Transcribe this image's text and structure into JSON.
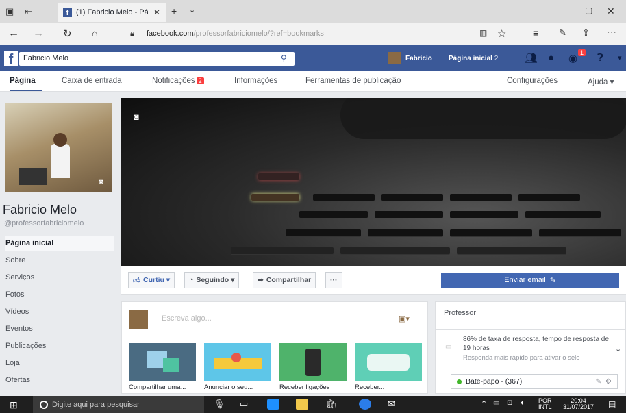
{
  "browser": {
    "tab_title": "(1) Fabricio Melo - Pági",
    "url_host": "facebook.com",
    "url_path": "/professorfabriciomelo/?ref=bookmarks",
    "fb_square": "f"
  },
  "fbbar": {
    "logo": "f",
    "search_value": "Fabricio Melo",
    "user_name": "Fabricio",
    "home_label": "Página inicial",
    "home_count": "2",
    "notif_count": "1"
  },
  "pagenav": {
    "tabs": [
      "Página",
      "Caixa de entrada",
      "Notificações",
      "Informações",
      "Ferramentas de publicação"
    ],
    "notif_badge": "2",
    "settings": "Configurações",
    "help": "Ajuda ▾"
  },
  "profile": {
    "name": "Fabricio Melo",
    "handle": "@professorfabriciomelo"
  },
  "sidebar": {
    "items": [
      "Página inicial",
      "Sobre",
      "Serviços",
      "Fotos",
      "Vídeos",
      "Eventos",
      "Publicações",
      "Loja",
      "Ofertas"
    ]
  },
  "actions": {
    "like": "Curtiu ▾",
    "follow": "Seguindo ▾",
    "share": "Compartilhar",
    "more": "···",
    "email": "Enviar email"
  },
  "composer": {
    "placeholder": "Escreva algo...",
    "tiles": [
      "Compartilhar uma...",
      "Anunciar o seu...",
      "Receber ligações",
      "Receber..."
    ]
  },
  "rightcard": {
    "title": "Professor",
    "response": "86% de taxa de resposta, tempo de resposta de 19 horas",
    "hint": "Responda mais rápido para ativar o selo"
  },
  "chat": {
    "label": "Bate-papo - (367)"
  },
  "taskbar": {
    "search_placeholder": "Digite aqui para pesquisar",
    "lang1": "POR",
    "lang2": "INTL",
    "time": "20:04",
    "date": "31/07/2017"
  },
  "colors": {
    "fb_blue": "#3b5998",
    "button_blue": "#4267b2",
    "badge_red": "#fa3e3e"
  }
}
